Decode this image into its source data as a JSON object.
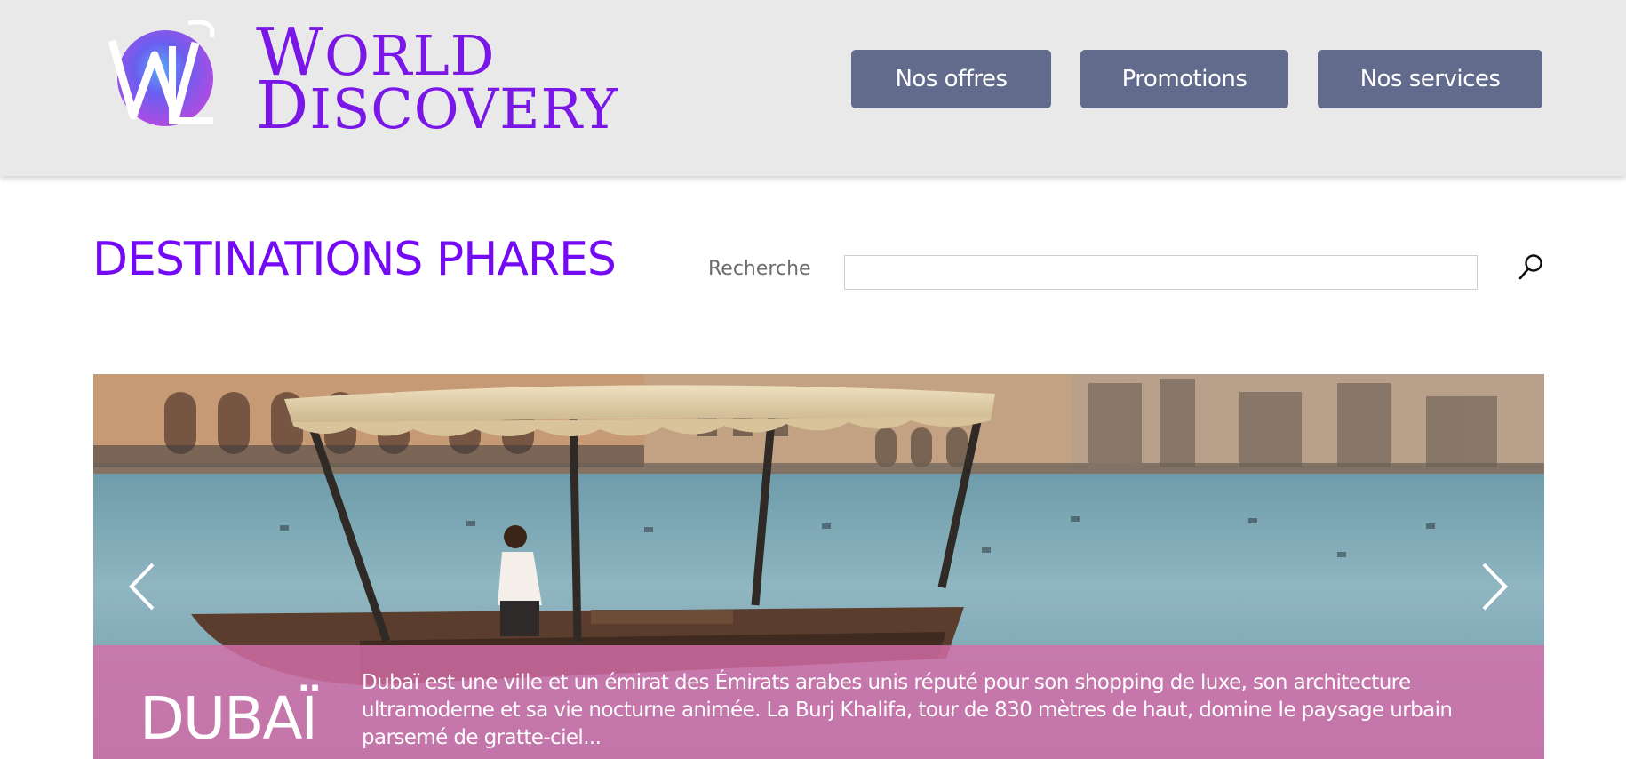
{
  "header": {
    "brand": {
      "line1_cap": "W",
      "line1_rest": "ORLD",
      "line2_cap": "D",
      "line2_rest": "ISCOVERY"
    },
    "logo_icon": "wd-monogram-logo",
    "nav": [
      {
        "label": "Nos offres"
      },
      {
        "label": "Promotions"
      },
      {
        "label": "Nos services"
      }
    ]
  },
  "main": {
    "title": "DESTINATIONS PHARES",
    "search": {
      "label": "Recherche",
      "value": "",
      "placeholder": "",
      "icon": "search-icon"
    }
  },
  "carousel": {
    "image": "dubai-abra-boat-photo",
    "prev_icon": "chevron-left-icon",
    "next_icon": "chevron-right-icon",
    "slide": {
      "title": "DUBAÏ",
      "description": "Dubaï est une ville et un émirat des Émirats arabes unis réputé pour son shopping de luxe, son architecture ultramoderne et sa vie nocturne animée. La Burj Khalifa, tour de 830 mètres de haut, domine le paysage urbain parsemé de gratte-ciel..."
    }
  },
  "colors": {
    "brand_purple": "#7a16e6",
    "nav_button": "#636b8c",
    "header_bg": "#e9e9ea",
    "caption_overlay": "#d66eaa"
  }
}
